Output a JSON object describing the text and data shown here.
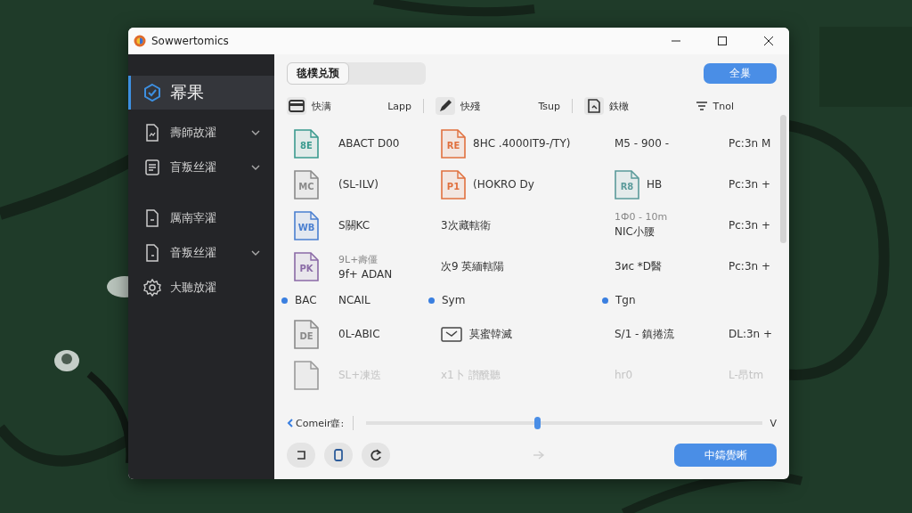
{
  "window": {
    "title": "Sowwertomics"
  },
  "sidebar": {
    "items": [
      {
        "label": "幂果",
        "selected": true,
        "expandable": false
      },
      {
        "label": "壽師故濯",
        "selected": false,
        "expandable": true
      },
      {
        "label": "盲叛丝濯",
        "selected": false,
        "expandable": true
      },
      {
        "label": "厲南宰濯",
        "selected": false,
        "expandable": false
      },
      {
        "label": "音叛丝濯",
        "selected": false,
        "expandable": true
      },
      {
        "label": "大聽放濯",
        "selected": false,
        "expandable": false
      }
    ]
  },
  "toolbar": {
    "segment": {
      "label": "毯樸兑预",
      "selected": true
    },
    "action_button": "全巢"
  },
  "columns": [
    {
      "label": "快满",
      "right_label": "Lapp"
    },
    {
      "label": "快殘",
      "right_label": "Tsup"
    },
    {
      "label": "鉄橄",
      "right_label": "Tnol"
    }
  ],
  "rows": [
    {
      "faded": false,
      "cells": [
        {
          "kind": "file",
          "icon": {
            "label": "8E",
            "color": "#3a9a8e"
          }
        },
        {
          "kind": "text",
          "lines": [
            "ABACT D00"
          ]
        },
        {
          "kind": "file-text",
          "icon": {
            "label": "RE",
            "color": "#e0703e"
          },
          "lines": [
            "8HC .4000IT9-/TY)"
          ]
        },
        {
          "kind": "text",
          "lines": [
            "M5 - 900 -"
          ]
        },
        {
          "kind": "text",
          "lines": [
            "Pc:3n M"
          ]
        }
      ]
    },
    {
      "faded": false,
      "cells": [
        {
          "kind": "file",
          "icon": {
            "label": "MC",
            "color": "#8a8a8a"
          }
        },
        {
          "kind": "text",
          "lines": [
            "(SL-ILV)"
          ]
        },
        {
          "kind": "file-text",
          "icon": {
            "label": "P1",
            "color": "#e0703e"
          },
          "lines": [
            "(HOKRO Dy"
          ]
        },
        {
          "kind": "file-text",
          "icon": {
            "label": "R8",
            "color": "#5a9a9a"
          },
          "lines": [
            "HB"
          ]
        },
        {
          "kind": "text",
          "lines": [
            "Pc:3n +"
          ]
        }
      ]
    },
    {
      "faded": false,
      "cells": [
        {
          "kind": "file",
          "icon": {
            "label": "WB",
            "color": "#4a7fd0"
          }
        },
        {
          "kind": "text",
          "lines": [
            "S關KC"
          ]
        },
        {
          "kind": "text",
          "lines": [
            "3次藏轄衛"
          ]
        },
        {
          "kind": "text",
          "lines": [
            "1Ф0 - 10m",
            "NIC小腰"
          ]
        },
        {
          "kind": "text",
          "lines": [
            "Pc:3n +"
          ]
        }
      ]
    },
    {
      "faded": false,
      "cells": [
        {
          "kind": "file",
          "icon": {
            "label": "PK",
            "color": "#8a6aa6"
          }
        },
        {
          "kind": "text",
          "lines": [
            "9L+壽僵",
            "9f+ ADAN"
          ]
        },
        {
          "kind": "text",
          "lines": [
            "次9 英緬轄陽"
          ]
        },
        {
          "kind": "text",
          "lines": [
            "3ис *D醫"
          ]
        },
        {
          "kind": "text",
          "lines": [
            "Pc:3n +"
          ]
        }
      ]
    },
    {
      "faded": false,
      "cells": [
        {
          "kind": "dot",
          "color": "#3a7fe0",
          "lines": [
            "BAC"
          ]
        },
        {
          "kind": "text",
          "lines": [
            "NCAIL"
          ]
        },
        {
          "kind": "dot",
          "color": "#3a7fe0",
          "lines": [
            "Sym"
          ]
        },
        {
          "kind": "dot",
          "color": "#3a7fe0",
          "lines": [
            "Tgn"
          ]
        }
      ]
    },
    {
      "faded": false,
      "cells": [
        {
          "kind": "file",
          "icon": {
            "label": "DE",
            "color": "#8a8a8a"
          }
        },
        {
          "kind": "text",
          "lines": [
            "0L-ABIC"
          ]
        },
        {
          "kind": "mail",
          "lines": [
            "莫蜜韓滅"
          ]
        },
        {
          "kind": "text",
          "lines": [
            "S/1 - 鎮捲流"
          ]
        },
        {
          "kind": "text",
          "lines": [
            "DL:3n +"
          ]
        }
      ]
    },
    {
      "faded": true,
      "cells": [
        {
          "kind": "file",
          "icon": {
            "color": "#9a9a9a"
          }
        },
        {
          "kind": "text",
          "lines": [
            "SL+凍迭"
          ]
        },
        {
          "kind": "text",
          "lines": [
            "x1卜 讃醗聽"
          ]
        },
        {
          "kind": "text",
          "lines": [
            "hr0"
          ]
        },
        {
          "kind": "text",
          "lines": [
            "L-昂tm"
          ]
        }
      ]
    }
  ],
  "slider": {
    "label": "Comeir韲:",
    "level": 0.43,
    "end_label": "V"
  },
  "primary_button": "中鑄覺晰"
}
